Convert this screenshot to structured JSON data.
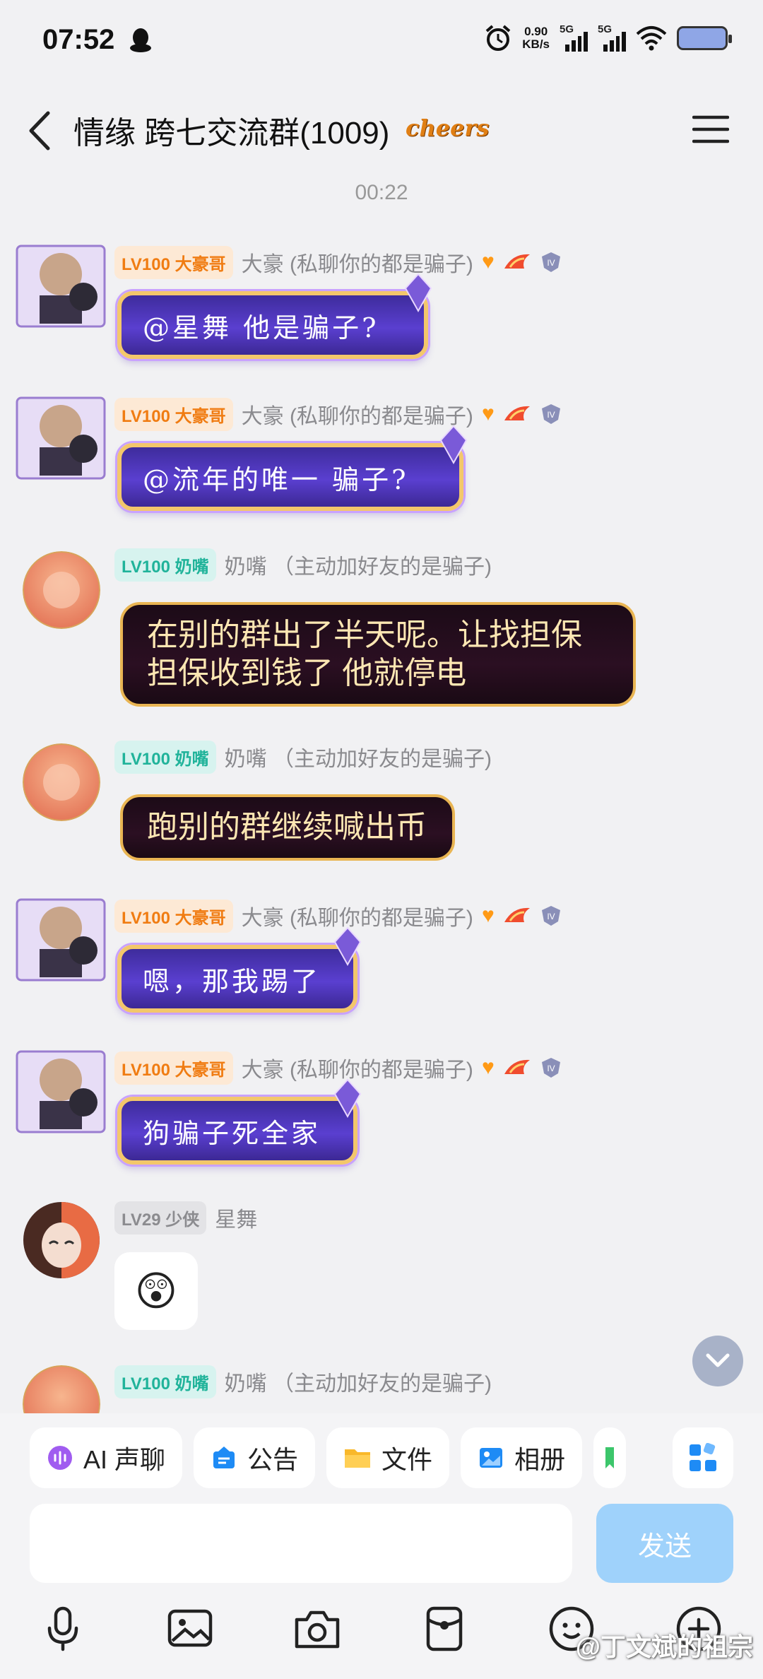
{
  "status_bar": {
    "time": "07:52",
    "net_speed_value": "0.90",
    "net_speed_unit": "KB/s",
    "signal1": "5G",
    "signal2": "5G"
  },
  "header": {
    "title": "情缘 跨七交流群(1009)",
    "cheers_badge": "cheers"
  },
  "timestamp": "00:22",
  "messages": [
    {
      "level": "LV100",
      "rank": "大豪哥",
      "nick": "大豪 (私聊你的都是骗子)",
      "text": "@星舞 他是骗子?"
    },
    {
      "level": "LV100",
      "rank": "大豪哥",
      "nick": "大豪 (私聊你的都是骗子)",
      "text": "@流年的唯一 骗子?"
    },
    {
      "level": "LV100",
      "rank": "奶嘴",
      "nick": "奶嘴 （主动加好友的是骗子)",
      "line1": "在别的群出了半天呢。让找担保",
      "line2": "担保收到钱了  他就停电"
    },
    {
      "level": "LV100",
      "rank": "奶嘴",
      "nick": "奶嘴 （主动加好友的是骗子)",
      "text": "跑别的群继续喊出币"
    },
    {
      "level": "LV100",
      "rank": "大豪哥",
      "nick": "大豪 (私聊你的都是骗子)",
      "text": "嗯，那我踢了"
    },
    {
      "level": "LV100",
      "rank": "大豪哥",
      "nick": "大豪 (私聊你的都是骗子)",
      "text": "狗骗子死全家"
    },
    {
      "level": "LV29",
      "rank": "少侠",
      "nick": "星舞",
      "text": "😲"
    },
    {
      "level": "LV100",
      "rank": "奶嘴",
      "nick": "奶嘴 （主动加好友的是骗子)"
    }
  ],
  "shortcuts": [
    {
      "label": "AI 声聊",
      "icon": "ai-voice-icon"
    },
    {
      "label": "公告",
      "icon": "announcement-icon"
    },
    {
      "label": "文件",
      "icon": "folder-icon"
    },
    {
      "label": "相册",
      "icon": "album-icon"
    }
  ],
  "send_label": "发送",
  "watermark": "@丁文斌的祖宗",
  "colors": {
    "accent_blue": "#1e8bf5",
    "send_disabled": "#9fd2fb",
    "level_gold": "#f07c12",
    "level_teal": "#20b39a"
  }
}
